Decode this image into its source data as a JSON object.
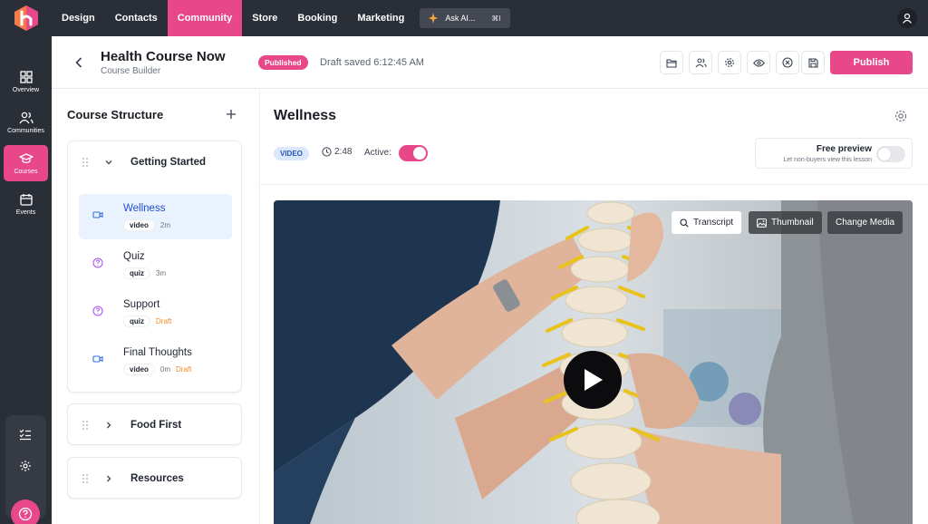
{
  "nav": {
    "items": [
      {
        "label": "Design",
        "active": false
      },
      {
        "label": "Contacts",
        "active": false
      },
      {
        "label": "Community",
        "active": true
      },
      {
        "label": "Store",
        "active": false
      },
      {
        "label": "Booking",
        "active": false
      },
      {
        "label": "Marketing",
        "active": false
      }
    ],
    "ask_ai": "Ask AI...",
    "ask_ai_shortcut": "⌘I"
  },
  "rail": {
    "items": [
      {
        "label": "Overview",
        "icon": "grid-icon"
      },
      {
        "label": "Communities",
        "icon": "people-icon"
      },
      {
        "label": "Courses",
        "icon": "graduation-cap-icon",
        "active": true
      },
      {
        "label": "Events",
        "icon": "calendar-icon"
      }
    ]
  },
  "header": {
    "title": "Health Course Now",
    "subtitle": "Course Builder",
    "status": "Published",
    "draft_saved": "Draft saved 6:12:45 AM",
    "publish_label": "Publish"
  },
  "sidebar": {
    "title": "Course Structure",
    "sections": [
      {
        "name": "Getting Started",
        "expanded": true,
        "lessons": [
          {
            "name": "Wellness",
            "type": "video",
            "duration": "2m",
            "draft": "",
            "active": true
          },
          {
            "name": "Quiz",
            "type": "quiz",
            "duration": "3m",
            "draft": ""
          },
          {
            "name": "Support",
            "type": "quiz",
            "duration": "",
            "draft": "Draft"
          },
          {
            "name": "Final Thoughts",
            "type": "video",
            "duration": "0m",
            "draft": "Draft"
          }
        ]
      },
      {
        "name": "Food First",
        "expanded": false
      },
      {
        "name": "Resources",
        "expanded": false
      }
    ]
  },
  "lesson": {
    "title": "Wellness",
    "type_badge": "VIDEO",
    "duration": "2:48",
    "active_label": "Active:",
    "active": true,
    "free_preview_title": "Free preview",
    "free_preview_sub": "Let non-buyers view this lesson",
    "free_preview": false
  },
  "video": {
    "transcript_label": "Transcript",
    "thumbnail_label": "Thumbnail",
    "change_media_label": "Change Media"
  },
  "colors": {
    "accent": "#e8488a",
    "nav_bg": "#2a2e36",
    "draft": "#f08a24",
    "selected_lesson_bg": "#eaf3fd"
  }
}
